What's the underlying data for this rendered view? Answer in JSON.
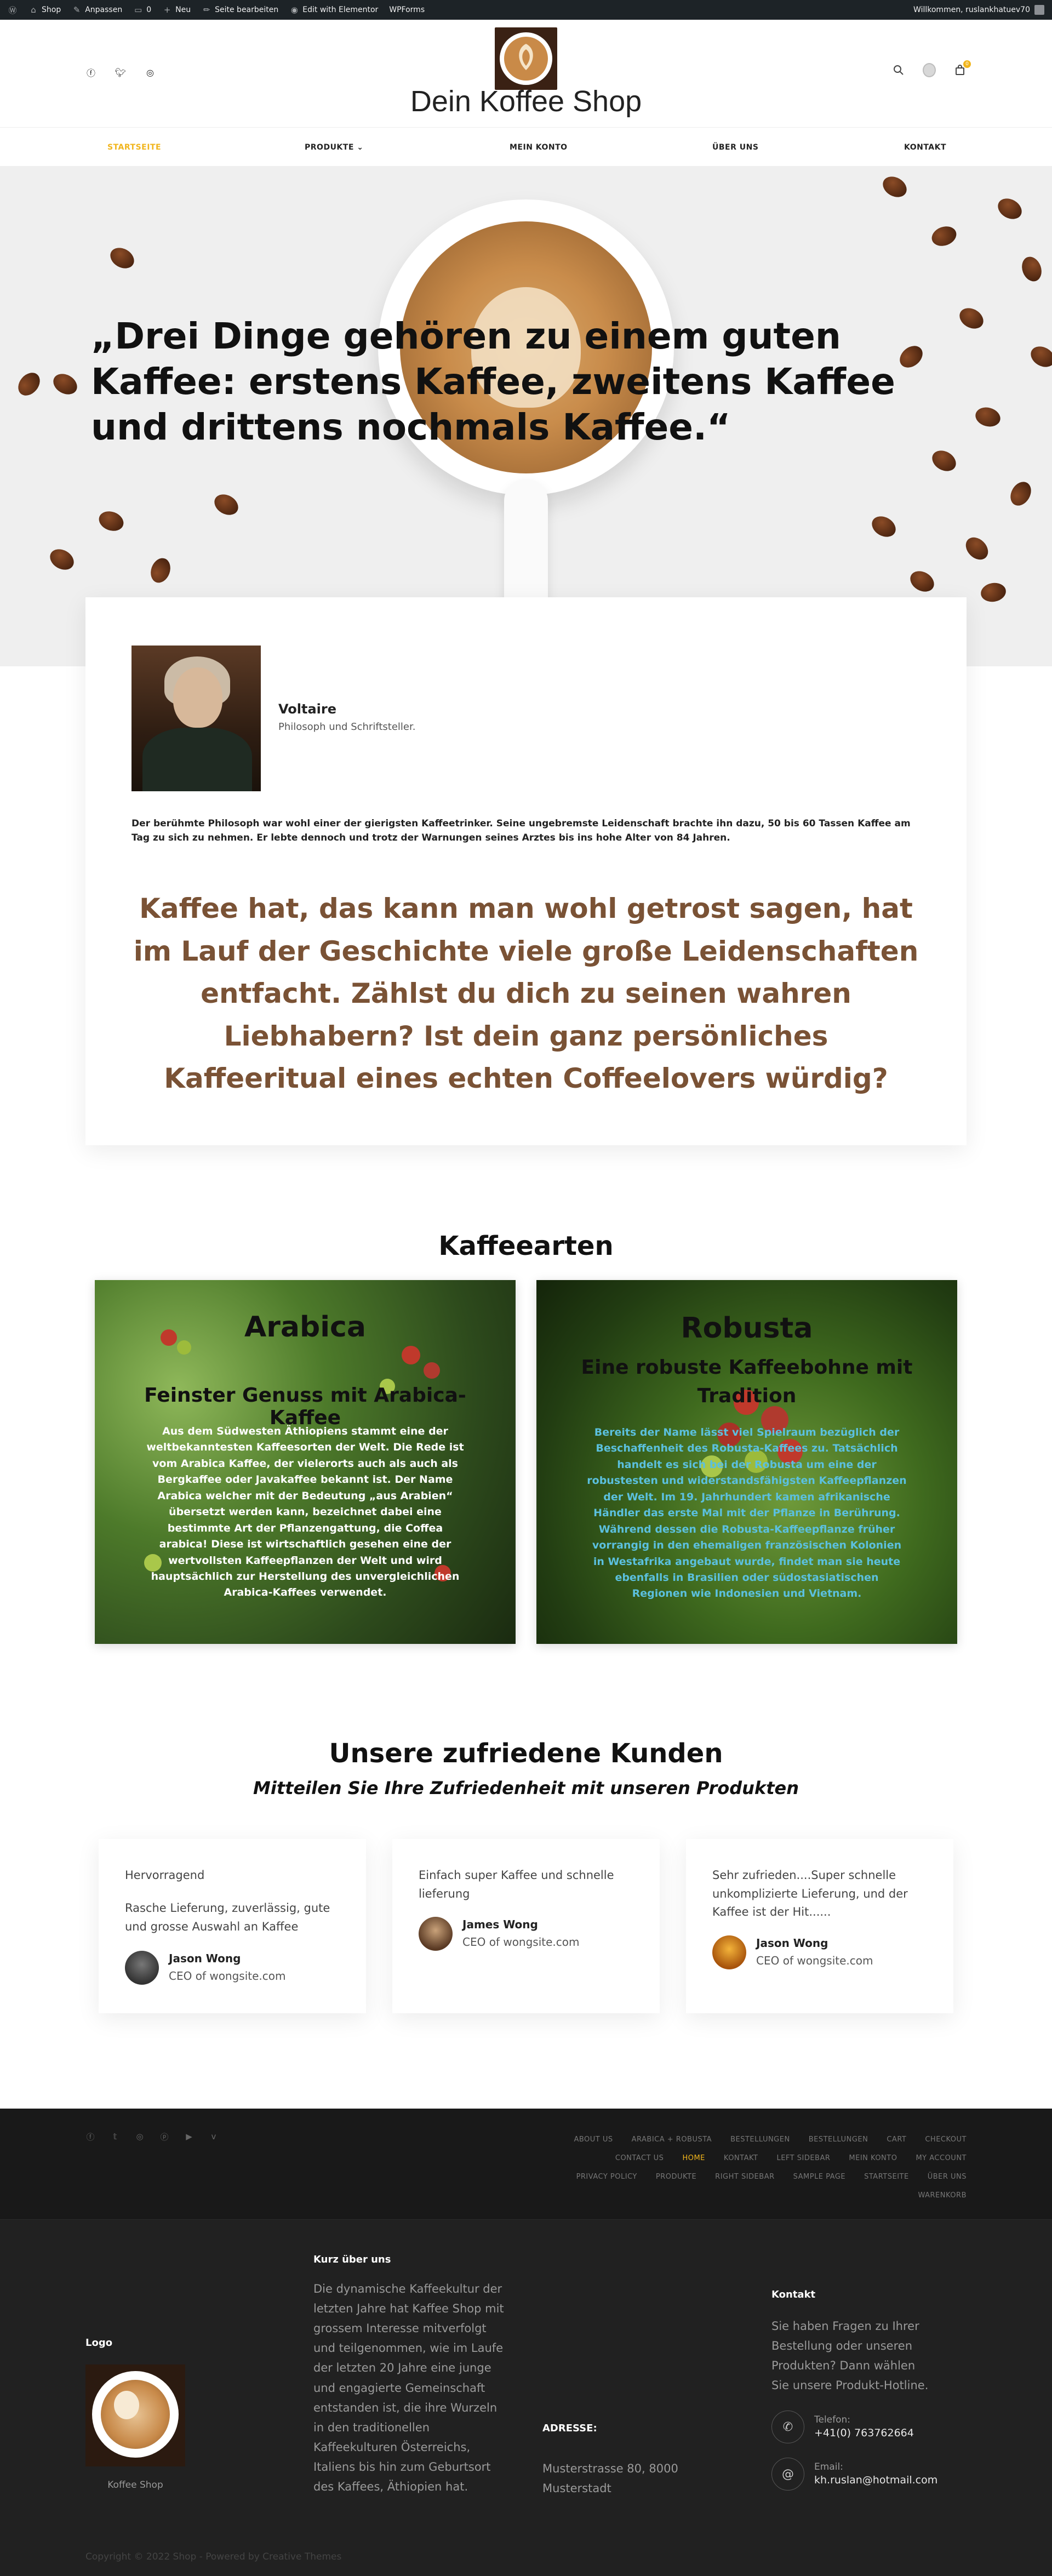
{
  "admin_bar": {
    "items": [
      "Shop",
      "Anpassen",
      "0",
      "Neu",
      "Seite bearbeiten",
      "Edit with Elementor",
      "WPForms"
    ],
    "greeting": "Willkommen, ruslankhatuev70"
  },
  "header": {
    "site_title": "Dein Koffee Shop",
    "social": [
      "facebook-icon",
      "twitter-icon",
      "instagram-icon"
    ],
    "cart_count": "0",
    "nav": [
      "STARTSEITE",
      "PRODUKTE",
      "MEIN KONTO",
      "ÜBER UNS",
      "KONTAKT"
    ],
    "active_nav": "STARTSEITE"
  },
  "hero": {
    "quote": "„Drei Dinge gehören zu einem guten Kaffee: erstens Kaffee, zweitens Kaffee und drittens nochmals Kaffee.“"
  },
  "author": {
    "name": "Voltaire",
    "role": "Philosoph und Schriftsteller.",
    "bio": "Der berühmte Philosoph war wohl einer der gierigsten Kaffeetrinker. Seine ungebremste Leidenschaft brachte ihn dazu, 50 bis 60 Tassen Kaffee am Tag zu sich zu nehmen. Er lebte dennoch und trotz der Warnungen seines Arztes bis ins hohe Alter von 84 Jahren.",
    "big_quote": "Kaffee hat, das kann man wohl getrost sagen, hat im Lauf der Geschichte viele große Leidenschaften entfacht. Zählst du dich zu seinen wahren Liebhabern? Ist dein ganz persönliches Kaffeeritual eines echten Coffeelovers würdig?"
  },
  "kaffeearten": {
    "title": "Kaffeearten",
    "arabica": {
      "title": "Arabica",
      "subtitle": "Feinster Genuss mit Arabica-Kaffee",
      "text": "Aus dem Südwesten Äthiopiens stammt eine der weltbekanntesten Kaffeesorten der Welt. Die Rede ist vom Arabica Kaffee, der vielerorts auch als auch als Bergkaffee oder Javakaffee bekannt ist. Der Name Arabica welcher mit der Bedeutung „aus Arabien“ übersetzt werden kann, bezeichnet dabei eine bestimmte Art der Pflanzengattung, die Coffea arabica! Diese ist wirtschaftlich gesehen eine der wertvollsten Kaffeepflanzen der Welt und wird hauptsächlich zur Herstellung des unvergleichlichen Arabica-Kaffees verwendet.",
      "text_color": "#ffffff"
    },
    "robusta": {
      "title": "Robusta",
      "subtitle": "Eine robuste Kaffeebohne mit Tradition",
      "text": "Bereits der Name lässt viel Spielraum bezüglich der Beschaffenheit des Robusta-Kaffees zu. Tatsächlich handelt es sich bei der Robusta um eine der robustesten und widerstandsfähigsten Kaffeepflanzen der Welt. Im 19. Jahrhundert kamen afrikanische Händler das erste Mal mit der Pflanze in Berührung. Während dessen die Robusta-Kaffeepflanze früher vorrangig in den ehemaligen französischen Kolonien in Westafrika angebaut wurde, findet man sie heute ebenfalls in Brasilien oder südostasiatischen Regionen wie Indonesien und Vietnam.",
      "text_color": "#5bc0de"
    }
  },
  "testimonials": {
    "title": "Unsere zufriedene Kunden",
    "subtitle": "Mitteilen Sie Ihre Zufriedenheit mit unseren Produkten",
    "items": [
      {
        "heading": "Hervorragend",
        "text": "Rasche Lieferung, zuverlässig, gute und grosse Auswahl an Kaffee",
        "name": "Jason Wong",
        "role": "CEO of wongsite.com"
      },
      {
        "heading": "",
        "text": "Einfach super Kaffee und schnelle lieferung",
        "name": "James Wong",
        "role": "CEO of wongsite.com"
      },
      {
        "heading": "",
        "text": "Sehr zufrieden....Super schnelle unkomplizierte Lieferung, und der Kaffee ist der Hit......",
        "name": "Jason Wong",
        "role": "CEO of wongsite.com"
      }
    ]
  },
  "footer_top": {
    "social": [
      "facebook-icon",
      "twitter-icon",
      "instagram-icon",
      "pinterest-icon",
      "youtube-icon",
      "vimeo-icon"
    ],
    "menu": [
      "ABOUT US",
      "ARABICA + ROBUSTA",
      "BESTELLUNGEN",
      "BESTELLUNGEN",
      "CART",
      "CHECKOUT",
      "CONTACT US",
      "HOME",
      "KONTAKT",
      "LEFT SIDEBAR",
      "MEIN KONTO",
      "MY ACCOUNT",
      "PRIVACY POLICY",
      "PRODUKTE",
      "RIGHT SIDEBAR",
      "SAMPLE PAGE",
      "STARTSEITE",
      "ÜBER UNS",
      "WARENKORB"
    ],
    "active": "HOME"
  },
  "footer": {
    "logo_heading": "Logo",
    "logo_caption": "Koffee Shop",
    "about_heading": "Kurz über uns",
    "about_text": "Die dynamische Kaffeekultur der letzten Jahre hat Kaffee Shop mit grossem Interesse mitverfolgt und teilgenommen, wie im Laufe der letzten 20 Jahre eine junge und engagierte Gemeinschaft entstanden ist, die ihre Wurzeln in den traditionellen Kaffeekulturen Österreichs, Italiens bis hin zum Geburtsort des Kaffees, Äthiopien hat.",
    "address_heading": "ADRESSE:",
    "address_text": "Musterstrasse 80, 8000 Musterstadt",
    "contact_heading": "Kontakt",
    "contact_text": "Sie haben Fragen zu Ihrer Bestellung oder unseren Produkten? Dann wählen Sie unsere Produkt-Hotline.",
    "phone_label": "Telefon:",
    "phone": "+41(0) 763762664",
    "email_label": "Email:",
    "email": "kh.ruslan@hotmail.com",
    "copyright": "Copyright © 2022 Shop - Powered by Creative Themes"
  },
  "colors": {
    "accent": "#f1b51c",
    "quote_brown": "#7a5235",
    "robusta_text": "#5bc0de",
    "footer_bg": "#212121"
  }
}
